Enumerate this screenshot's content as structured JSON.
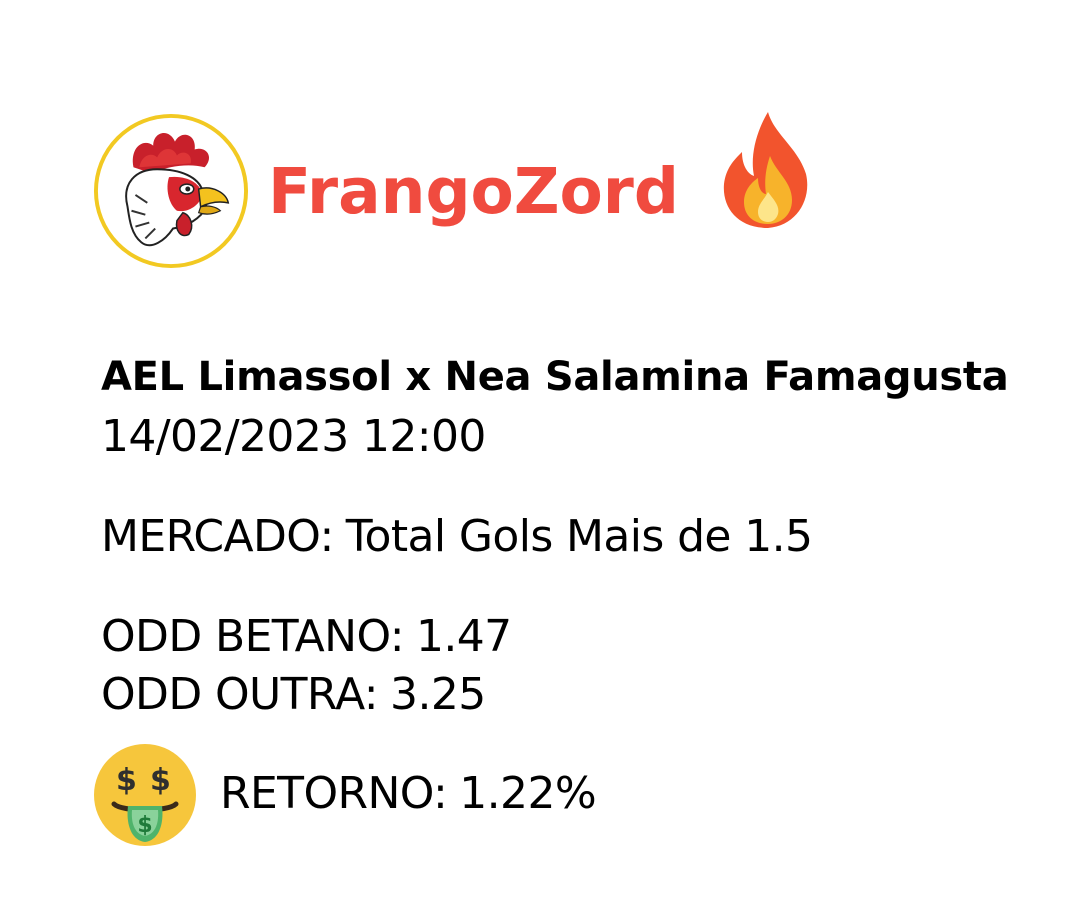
{
  "brand": {
    "name": "FrangoZord",
    "color": "#f04b3f",
    "logo_icon": "rooster-logo-icon",
    "badge_icon": "fire-icon"
  },
  "match": {
    "title": "AEL Limassol x Nea Salamina Famagusta",
    "datetime": "14/02/2023 12:00"
  },
  "market": {
    "label": "MERCADO:",
    "value": "Total Gols Mais de 1.5"
  },
  "odds": {
    "betano_label": "ODD BETANO:",
    "betano_value": "1.47",
    "outra_label": "ODD OUTRA:",
    "outra_value": "3.25"
  },
  "retorno": {
    "icon": "money-mouth-face-icon",
    "label": "RETORNO:",
    "value": "1.22%"
  }
}
